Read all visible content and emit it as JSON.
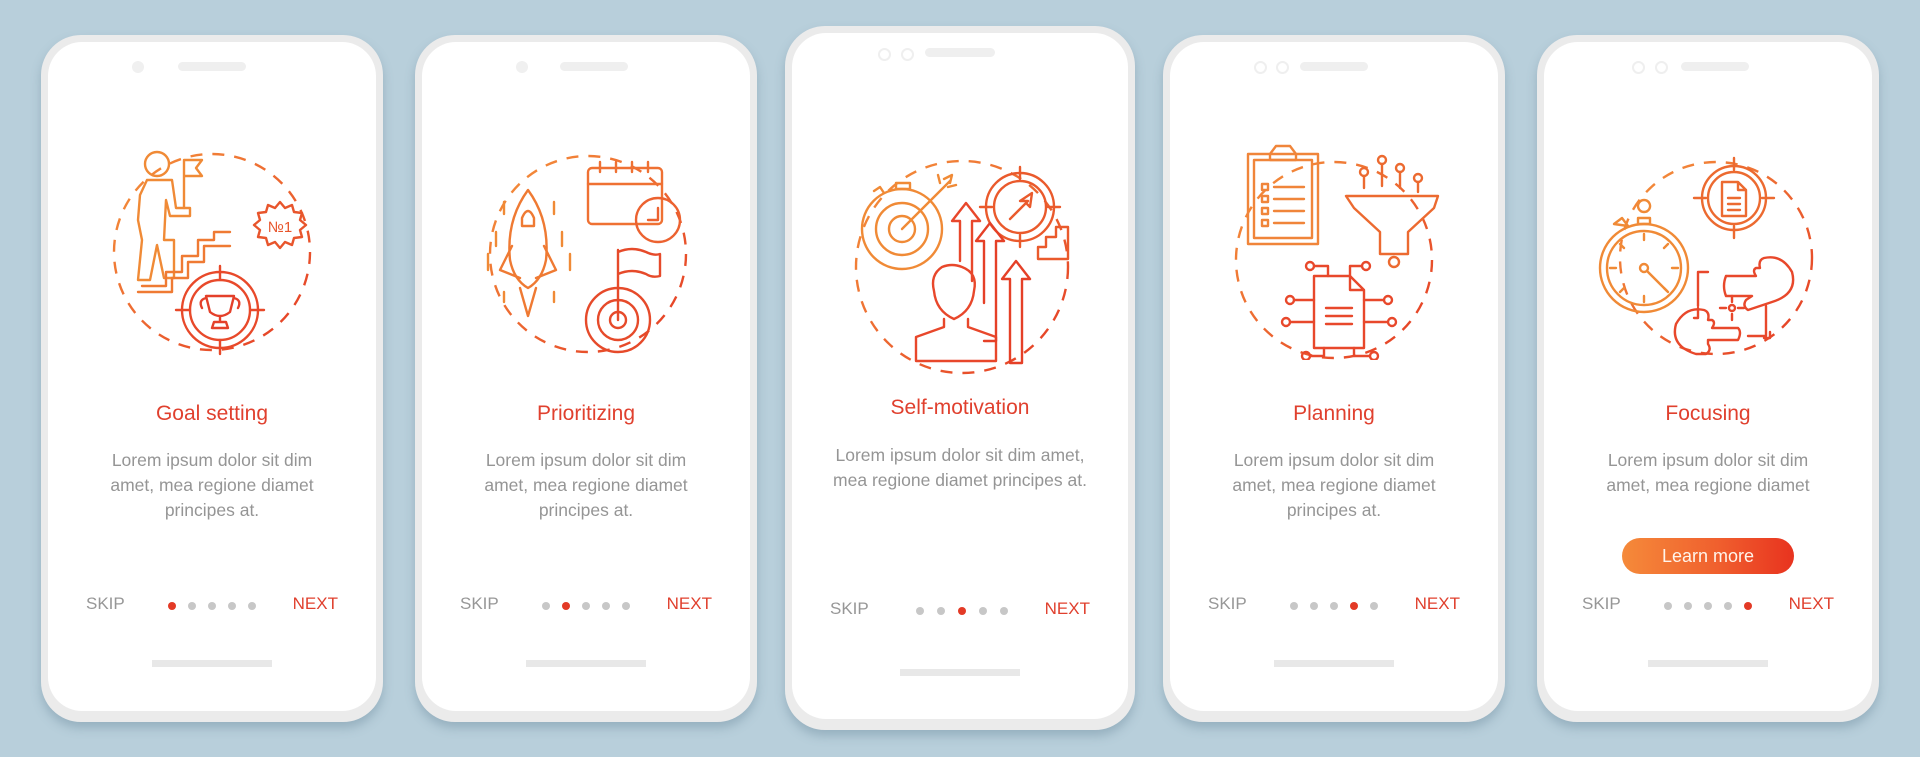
{
  "theme": {
    "background": "#b8cfdb",
    "accent": "#e0402e",
    "gradient_start": "#f58a3a",
    "gradient_end": "#e8331f",
    "inactive_dot": "#c7c7c7",
    "body_text": "#959595"
  },
  "screens": [
    {
      "title": "Goal setting",
      "description": "Lorem ipsum dolor sit dim amet, mea regione diamet principes at.",
      "illustration": "goal-setting-illustration",
      "skip_label": "SKIP",
      "next_label": "NEXT",
      "page_count": 5,
      "active_page": 1
    },
    {
      "title": "Prioritizing",
      "description": "Lorem ipsum dolor sit dim amet, mea regione diamet principes at.",
      "illustration": "prioritizing-illustration",
      "skip_label": "SKIP",
      "next_label": "NEXT",
      "page_count": 5,
      "active_page": 2
    },
    {
      "title": "Self-motivation",
      "description": "Lorem ipsum dolor sit dim amet, mea regione diamet principes at.",
      "illustration": "self-motivation-illustration",
      "skip_label": "SKIP",
      "next_label": "NEXT",
      "page_count": 5,
      "active_page": 3
    },
    {
      "title": "Planning",
      "description": "Lorem ipsum dolor sit dim amet, mea regione diamet principes at.",
      "illustration": "planning-illustration",
      "skip_label": "SKIP",
      "next_label": "NEXT",
      "page_count": 5,
      "active_page": 4
    },
    {
      "title": "Focusing",
      "description": "Lorem ipsum dolor sit dim amet, mea regione diamet",
      "illustration": "focusing-illustration",
      "button_label": "Learn more",
      "skip_label": "SKIP",
      "next_label": "NEXT",
      "page_count": 5,
      "active_page": 5
    }
  ],
  "badge_text": "№1"
}
